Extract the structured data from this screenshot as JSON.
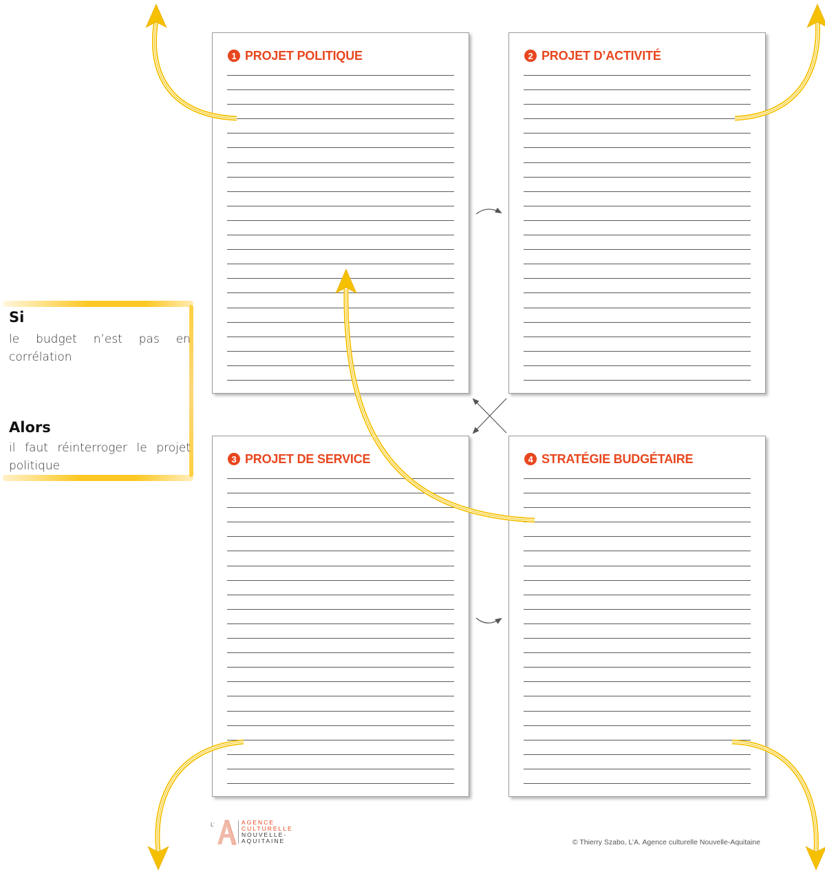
{
  "accent_color": "#e8461e",
  "arrow_color": "#f5c000",
  "cards": [
    {
      "number": "1",
      "title": "PROJET POLITIQUE"
    },
    {
      "number": "2",
      "title": "PROJET D’ACTIVITÉ"
    },
    {
      "number": "3",
      "title": "PROJET DE SERVICE"
    },
    {
      "number": "4",
      "title": "STRATÉGIE BUDGÉTAIRE"
    }
  ],
  "callout": {
    "si_label": "Si",
    "si_text": "le budget n’est pas en corrélation",
    "alors_label": "Alors",
    "alors_text": "il faut réinterroger le projet politique"
  },
  "logo": {
    "mark": "L’",
    "lines": [
      "AGENCE",
      "CULTURELLE",
      "NOUVELLE-",
      "AQUITAINE"
    ]
  },
  "footer": {
    "credit": "© Thierry Szabo, L’A. Agence culturelle Nouvelle-Aquitaine"
  }
}
